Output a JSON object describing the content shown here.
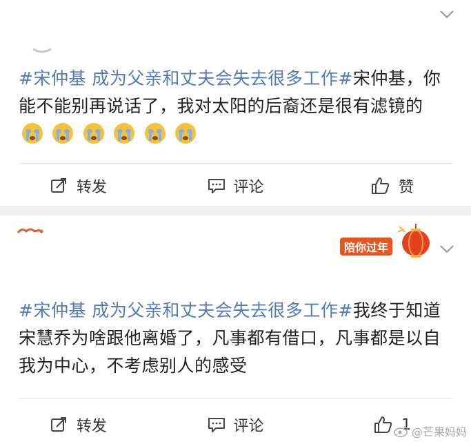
{
  "posts": [
    {
      "hashtag": "#宋仲基 成为父亲和丈夫会失去很多工作#",
      "body": "宋仲基，你能不能别再说话了，我对太阳的后裔还是很有滤镜的",
      "emoji": [
        "crying-emoji",
        "crying-emoji",
        "crying-emoji",
        "crying-emoji",
        "crying-emoji",
        "crying-emoji"
      ],
      "actions": {
        "repost": "转发",
        "comment": "评论",
        "like": "赞"
      }
    },
    {
      "badge": "陪你过年",
      "hashtag": "#宋仲基 成为父亲和丈夫会失去很多工作#",
      "body": "我终于知道宋慧乔为啥跟他离婚了，凡事都有借口，凡事都是以自我为中心，不考虑别人的感受",
      "actions": {
        "repost": "转发",
        "comment": "评论",
        "like": "1"
      }
    }
  ],
  "watermark": "@芒果妈妈",
  "colors": {
    "hashtag": "#4f7db8",
    "separator": "#efefef",
    "badge": "#e8561f"
  }
}
